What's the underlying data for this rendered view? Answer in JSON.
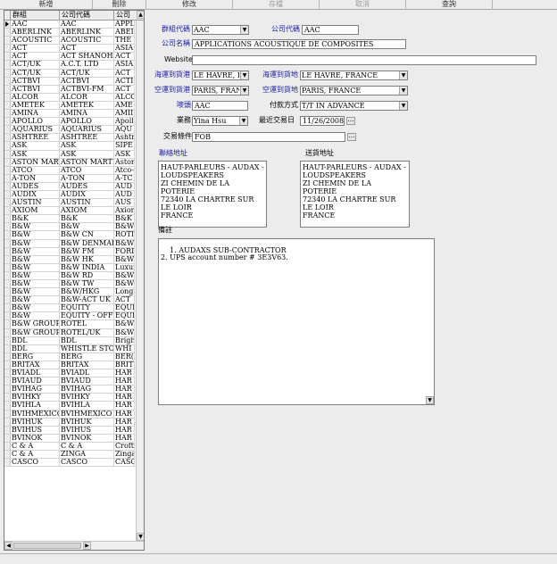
{
  "toolbar": {
    "buttons": [
      {
        "label": "新增",
        "enabled": true
      },
      {
        "label": "刪除",
        "enabled": true
      },
      {
        "label": "修改",
        "enabled": true
      },
      {
        "label": "存檔",
        "enabled": false
      },
      {
        "label": "取消",
        "enabled": false
      },
      {
        "label": "查詢",
        "enabled": true
      }
    ]
  },
  "grid": {
    "columns": [
      "群組",
      "公司代碼",
      "公司"
    ],
    "rows": [
      [
        "AAC",
        "AAC",
        "APPL"
      ],
      [
        "ABERLINK",
        "ABERLINK",
        "ABEI"
      ],
      [
        "ACOUSTIC",
        "ACOUSTIC",
        "THE"
      ],
      [
        "ACT",
        "ACT",
        "ASIA"
      ],
      [
        "ACT",
        "ACT SHANOHAI",
        "ACT"
      ],
      [
        "ACT/UK",
        "A.C.T. LTD",
        "ASIA"
      ],
      [
        "ACT/UK",
        "ACT/UK",
        "ACT"
      ],
      [
        "ACTBVI",
        "ACTBVI",
        "ACTI"
      ],
      [
        "ACTBVI",
        "ACTBVI-FM",
        "ACT"
      ],
      [
        "ALCOR",
        "ALCOR",
        "ALCO"
      ],
      [
        "AMETEK",
        "AMETEK",
        "AME"
      ],
      [
        "AMINA",
        "AMINA",
        "AMII"
      ],
      [
        "APOLLO",
        "APOLLO",
        "Apoll"
      ],
      [
        "AQUARIUS",
        "AQUARIUS",
        "AQU"
      ],
      [
        "ASHTREE",
        "ASHTREE",
        "Ashtr"
      ],
      [
        "ASK",
        "ASK",
        "SIPE"
      ],
      [
        "ASK",
        "ASK",
        "ASK"
      ],
      [
        "ASTON MART",
        "ASTON MARTIN",
        "Astor"
      ],
      [
        "ATCO",
        "ATCO",
        "Atco-"
      ],
      [
        "A-TON",
        "A-TON",
        "A-TC"
      ],
      [
        "AUDES",
        "AUDES",
        "AUD"
      ],
      [
        "AUDIX",
        "AUDIX",
        "AUD"
      ],
      [
        "AUSTIN",
        "AUSTIN",
        "AUS"
      ],
      [
        "AXIOM",
        "AXIOM",
        "Axion"
      ],
      [
        "B&K",
        "B&K",
        "B&K"
      ],
      [
        "B&W",
        "B&W",
        "B&W"
      ],
      [
        "B&W",
        "B&W CN",
        "ROTI"
      ],
      [
        "B&W",
        "B&W DENMARK",
        "B&W"
      ],
      [
        "B&W",
        "B&W FM",
        "FORI"
      ],
      [
        "B&W",
        "B&W HK",
        "B&W"
      ],
      [
        "B&W",
        "B&W INDIA",
        "Luxur"
      ],
      [
        "B&W",
        "B&W RD",
        "B&W"
      ],
      [
        "B&W",
        "B&W TW",
        "B&W"
      ],
      [
        "B&W",
        "B&W/HKG",
        "Long"
      ],
      [
        "B&W",
        "B&W-ACT UK",
        "ACT"
      ],
      [
        "B&W",
        "EQUITY",
        "EQUI"
      ],
      [
        "B&W",
        "EQUITY - OFFICE",
        "EQUI"
      ],
      [
        "B&W GROUP",
        "ROTEL",
        "B&W"
      ],
      [
        "B&W GROUP",
        "ROTEL/UK",
        "B&W"
      ],
      [
        "BDL",
        "BDL",
        "Brigh"
      ],
      [
        "BDL",
        "WHISTLE STOP",
        "WHI"
      ],
      [
        "BERG",
        "BERG",
        "BER("
      ],
      [
        "BRITAX",
        "BRITAX",
        "BRIT"
      ],
      [
        "BVIADL",
        "BVIADL",
        "HAR"
      ],
      [
        "BVIAUD",
        "BVIAUD",
        "HAR"
      ],
      [
        "BVIHAG",
        "BVIHAG",
        "HAR"
      ],
      [
        "BVIHKY",
        "BVIHKY",
        "HAR"
      ],
      [
        "BVIHLA",
        "BVIHLA",
        "HAR"
      ],
      [
        "BVIHMEXICO",
        "BVIHMEXICO",
        "HAR"
      ],
      [
        "BVIHUK",
        "BVIHUK",
        "HAR"
      ],
      [
        "BVIHUS",
        "BVIHUS",
        "HAR"
      ],
      [
        "BVINOK",
        "BVINOK",
        "HAR"
      ],
      [
        "C & A",
        "C & A",
        "Croft"
      ],
      [
        "C & A",
        "ZINGA",
        "Zinga"
      ],
      [
        "CASCO",
        "CASCO",
        "CASC"
      ]
    ]
  },
  "form": {
    "group_label": "群組代碼",
    "group_value": "AAC",
    "company_code_label": "公司代碼",
    "company_code_value": "AAC",
    "company_name_label": "公司名稱",
    "company_name_value": "APPLICATIONS ACOUSTIQUE  DE COMPOSITES",
    "website_label": "Website",
    "website_value": "",
    "sea_port_label": "海運到貨港",
    "sea_port_value": "LE HAVRE, FR",
    "sea_dest_label": "海運到貨地",
    "sea_dest_value": "LE HAVRE, FRANCE",
    "air_port_label": "空運到貨港",
    "air_port_value": "PARIS, FRANC",
    "air_dest_label": "空運到貨地",
    "air_dest_value": "PARIS, FRANCE",
    "mark_label": "嘜頭",
    "mark_value": "AAC",
    "payment_label": "付款方式",
    "payment_value": "T/T IN ADVANCE",
    "sales_label": "業務",
    "sales_value": "Yina Hsu",
    "last_trade_label": "最近交易日",
    "last_trade_value": "11/26/2008",
    "terms_label": "交易條件",
    "terms_value": "FOB",
    "contact_addr_label": "聯絡地址",
    "contact_addr_value": "HAUT-PARLEURS - AUDAX -\nLOUDSPEAKERS\nZI CHEMIN DE LA POTERIE\n72340 LA CHARTRE SUR LE LOIR\nFRANCE",
    "delivery_addr_label": "送貨地址",
    "delivery_addr_value": "HAUT-PARLEURS - AUDAX -\nLOUDSPEAKERS\nZI CHEMIN DE LA POTERIE\n72340 LA CHARTRE SUR LE LOIR\nFRANCE",
    "memo_label": "備註",
    "memo_value": "1. AUDAXS SUB-CONTRACTOR\n2. UPS account number # 3E3V63."
  },
  "colors": {
    "label_blue": "#1a1aa8",
    "panel": "#ececec"
  },
  "icons": {
    "dropdown": "▼",
    "ellipsis": "…",
    "up": "▲",
    "down": "▼",
    "left": "◀",
    "right": "▶",
    "current_row": "▶"
  }
}
